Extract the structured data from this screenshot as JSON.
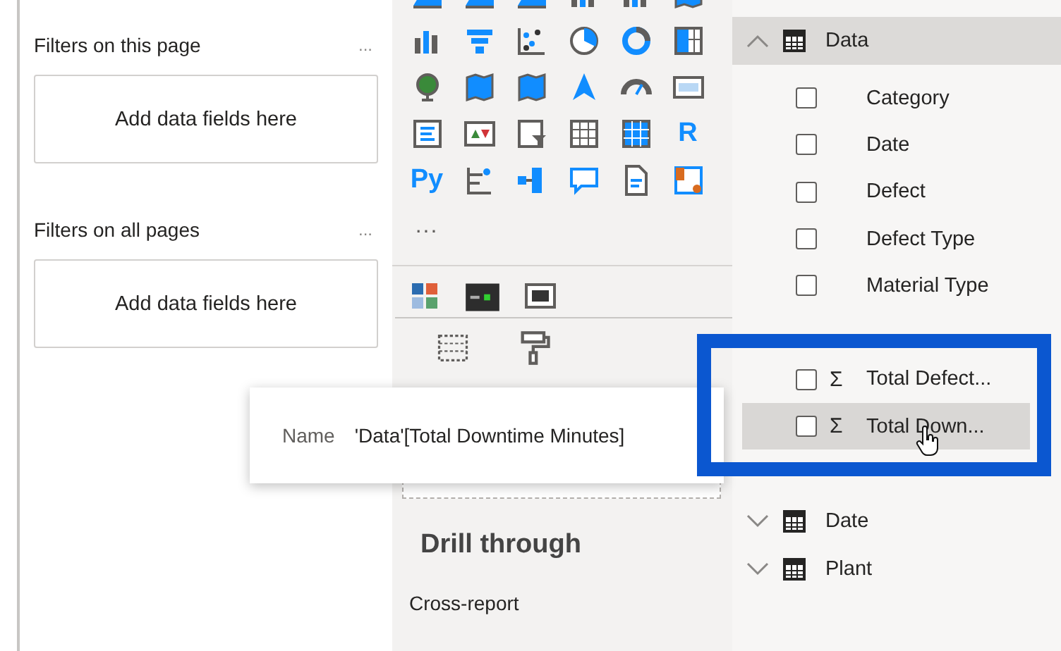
{
  "filters": {
    "sections": [
      {
        "title": "Filters on this page",
        "more": "...",
        "drop_hint": "Add data fields here"
      },
      {
        "title": "Filters on all pages",
        "more": "...",
        "drop_hint": "Add data fields here"
      }
    ]
  },
  "visualizations": {
    "text_icons": [
      "R",
      "Py"
    ],
    "more": "...",
    "drill_through": {
      "title": "Drill through",
      "option": "Cross-report"
    }
  },
  "fields": {
    "tables": [
      {
        "name": "Data",
        "expanded": true,
        "selected": true,
        "fields": [
          {
            "name": "Category",
            "kind": "column",
            "checked": false,
            "hovered": false
          },
          {
            "name": "Date",
            "kind": "column",
            "checked": false,
            "hovered": false
          },
          {
            "name": "Defect",
            "kind": "column",
            "checked": false,
            "hovered": false
          },
          {
            "name": "Defect Type",
            "kind": "column",
            "checked": false,
            "hovered": false
          },
          {
            "name": "Material Type",
            "kind": "column",
            "checked": false,
            "hovered": false
          },
          {
            "kind": "hidden"
          },
          {
            "name": "Total Defect...",
            "kind": "measure",
            "symbol": "Σ",
            "checked": false,
            "hovered": false
          },
          {
            "name": "Total Down...",
            "kind": "measure",
            "symbol": "Σ",
            "checked": false,
            "hovered": true
          },
          {
            "kind": "hidden"
          }
        ]
      },
      {
        "name": "Date",
        "expanded": false,
        "selected": false
      },
      {
        "name": "Plant",
        "expanded": false,
        "selected": false
      }
    ]
  },
  "tooltip": {
    "label": "Name",
    "value": "'Data'[Total Downtime Minutes]"
  }
}
